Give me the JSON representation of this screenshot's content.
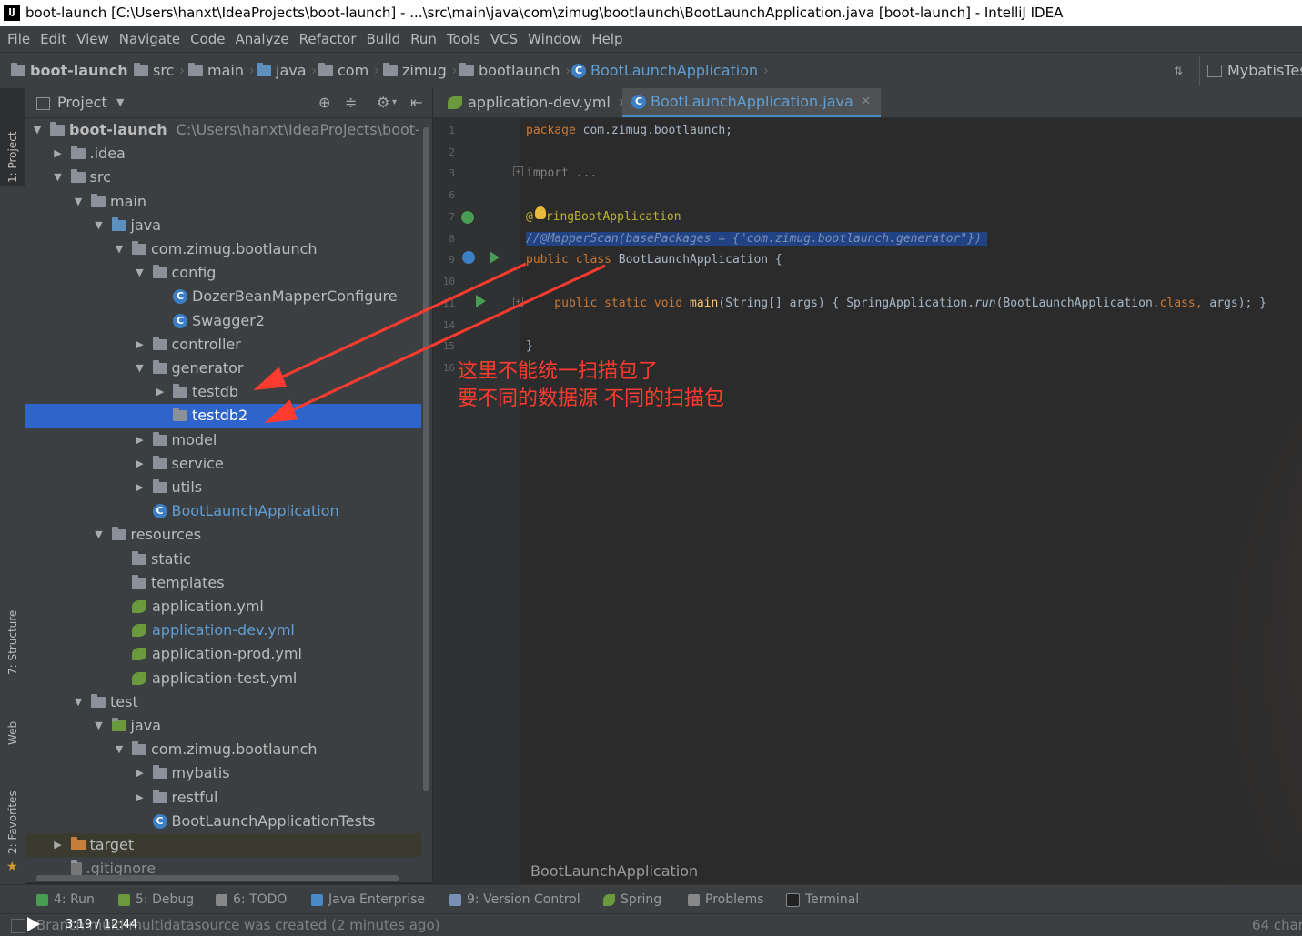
{
  "window": {
    "app_badge": "IJ",
    "title": "boot-launch [C:\\Users\\hanxt\\IdeaProjects\\boot-launch] - ...\\src\\main\\java\\com\\zimug\\bootlaunch\\BootLaunchApplication.java [boot-launch] - IntelliJ IDEA"
  },
  "menu": [
    "File",
    "Edit",
    "View",
    "Navigate",
    "Code",
    "Analyze",
    "Refactor",
    "Build",
    "Run",
    "Tools",
    "VCS",
    "Window",
    "Help"
  ],
  "navbar": {
    "crumbs": [
      "boot-launch",
      "src",
      "main",
      "java",
      "com",
      "zimug",
      "bootlaunch",
      "BootLaunchApplication"
    ],
    "run_config": "MybatisTes"
  },
  "left_strip": {
    "project": "1: Project",
    "structure": "7: Structure",
    "web": "Web",
    "favorites": "2: Favorites"
  },
  "project_panel": {
    "title": "Project",
    "tree": [
      {
        "label": "boot-launch",
        "extra": "C:\\Users\\hanxt\\IdeaProjects\\boot-launch",
        "level": 0,
        "arrow": "down",
        "icon": "folder",
        "bold": true
      },
      {
        "label": ".idea",
        "level": 1,
        "arrow": "right",
        "icon": "folder"
      },
      {
        "label": "src",
        "level": 1,
        "arrow": "down",
        "icon": "folder"
      },
      {
        "label": "main",
        "level": 2,
        "arrow": "down",
        "icon": "folder"
      },
      {
        "label": "java",
        "level": 3,
        "arrow": "down",
        "icon": "folder-blue"
      },
      {
        "label": "com.zimug.bootlaunch",
        "level": 4,
        "arrow": "down",
        "icon": "package"
      },
      {
        "label": "config",
        "level": 5,
        "arrow": "down",
        "icon": "package"
      },
      {
        "label": "DozerBeanMapperConfigure",
        "level": 6,
        "arrow": "",
        "icon": "class"
      },
      {
        "label": "Swagger2",
        "level": 6,
        "arrow": "",
        "icon": "class"
      },
      {
        "label": "controller",
        "level": 5,
        "arrow": "right",
        "icon": "package"
      },
      {
        "label": "generator",
        "level": 5,
        "arrow": "down",
        "icon": "package"
      },
      {
        "label": "testdb",
        "level": 6,
        "arrow": "right",
        "icon": "package"
      },
      {
        "label": "testdb2",
        "level": 6,
        "arrow": "",
        "icon": "package",
        "selected": true
      },
      {
        "label": "model",
        "level": 5,
        "arrow": "right",
        "icon": "package"
      },
      {
        "label": "service",
        "level": 5,
        "arrow": "right",
        "icon": "package"
      },
      {
        "label": "utils",
        "level": 5,
        "arrow": "right",
        "icon": "package"
      },
      {
        "label": "BootLaunchApplication",
        "level": 5,
        "arrow": "",
        "icon": "spring-class",
        "blue": true
      },
      {
        "label": "resources",
        "level": 3,
        "arrow": "down",
        "icon": "folder"
      },
      {
        "label": "static",
        "level": 4,
        "arrow": "",
        "icon": "package"
      },
      {
        "label": "templates",
        "level": 4,
        "arrow": "",
        "icon": "package"
      },
      {
        "label": "application.yml",
        "level": 4,
        "arrow": "",
        "icon": "yml"
      },
      {
        "label": "application-dev.yml",
        "level": 4,
        "arrow": "",
        "icon": "yml",
        "blue": true
      },
      {
        "label": "application-prod.yml",
        "level": 4,
        "arrow": "",
        "icon": "yml"
      },
      {
        "label": "application-test.yml",
        "level": 4,
        "arrow": "",
        "icon": "yml"
      },
      {
        "label": "test",
        "level": 2,
        "arrow": "down",
        "icon": "folder"
      },
      {
        "label": "java",
        "level": 3,
        "arrow": "down",
        "icon": "folder-green"
      },
      {
        "label": "com.zimug.bootlaunch",
        "level": 4,
        "arrow": "down",
        "icon": "package"
      },
      {
        "label": "mybatis",
        "level": 5,
        "arrow": "right",
        "icon": "package"
      },
      {
        "label": "restful",
        "level": 5,
        "arrow": "right",
        "icon": "package"
      },
      {
        "label": "BootLaunchApplicationTests",
        "level": 5,
        "arrow": "",
        "icon": "spring-class"
      },
      {
        "label": "target",
        "level": 1,
        "arrow": "right",
        "icon": "folder-orange"
      },
      {
        "label": ".gitignore",
        "level": 1,
        "arrow": "",
        "icon": "file"
      }
    ]
  },
  "editor": {
    "tabs": [
      {
        "label": "application-dev.yml",
        "active": false
      },
      {
        "label": "BootLaunchApplication.java",
        "active": true
      }
    ],
    "line_numbers": [
      "1",
      "2",
      "3",
      "6",
      "7",
      "8",
      "9",
      "10",
      "11",
      "14",
      "15",
      "16"
    ],
    "code": {
      "l1_kw": "package",
      "l1_rest": " com.zimug.bootlaunch;",
      "l3": "import ...",
      "l7_at": "@",
      "l7_rest": "ringBootApplication",
      "l8": "//@MapperScan(basePackages = {\"com.zimug.bootlaunch.generator\"})",
      "l9_kw": "public class ",
      "l9_rest": "BootLaunchApplication {",
      "l11_kw": "    public static void ",
      "l11_fn": "main",
      "l11_rest": "(String[] args) { SpringApplication.",
      "l11_run": "run",
      "l11_rest2": "(BootLaunchApplication.",
      "l11_cls": "class,",
      "l11_end": " args); }",
      "l15": "}"
    },
    "annotation_line1": "这里不能统一扫描包了",
    "annotation_line2": "要不同的数据源    不同的扫描包",
    "breadcrumb": "BootLaunchApplication"
  },
  "bottom_tabs": [
    "4: Run",
    "5: Debug",
    "6: TODO",
    "Java Enterprise",
    "9: Version Control",
    "Spring",
    "Problems",
    "Terminal"
  ],
  "status": {
    "message": "Branch multi-multidatasource was created (2 minutes ago)",
    "right": "64 char",
    "video_time": "3:19 / 12:44"
  },
  "colors": {
    "selection": "#2f65ca",
    "annotation_red": "#ff3b30",
    "keyword": "#cc7832"
  }
}
